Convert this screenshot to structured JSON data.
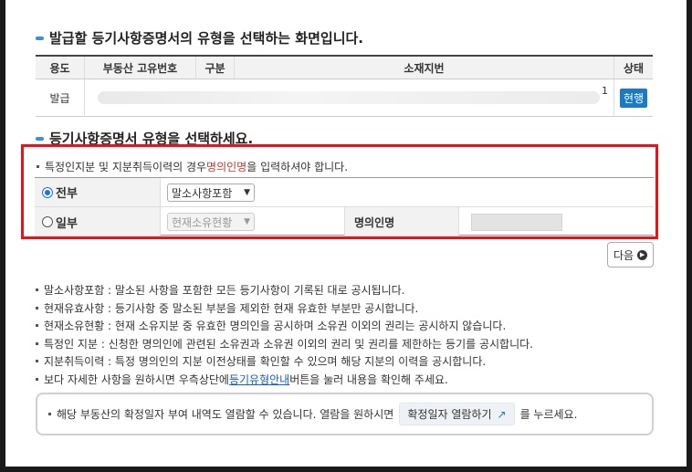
{
  "section1_title": "발급할 등기사항증명서의 유형을 선택하는 화면입니다.",
  "table": {
    "headers": [
      "용도",
      "부동산 고유번호",
      "구분",
      "소재지번",
      "상태"
    ],
    "row": {
      "usage": "발급",
      "address_suffix": "1",
      "status": "현행"
    }
  },
  "section2_title": "등기사항증명서 유형을 선택하세요.",
  "notice": {
    "pre": "특정인지분 및 지분취득이력의 경우 ",
    "highlight": "명의인명",
    "post": "을 입력하셔야 합니다."
  },
  "options": {
    "full": {
      "label": "전부",
      "select_value": "말소사항포함",
      "checked": true
    },
    "partial": {
      "label": "일부",
      "select_value": "현재소유현황",
      "checked": false
    },
    "owner_label": "명의인명"
  },
  "next_button": "다음",
  "info": [
    "말소사항포함 : 말소된 사항을 포함한 모든 등기사항이 기록된 대로 공시됩니다.",
    "현재유효사항 : 등기사항 중 말소된 부분을 제외한 현재 유효한 부분만 공시합니다.",
    "현재소유현황 : 현재 소유지분 중 유효한 명의인을 공시하며 소유권 이외의 권리는 공시하지 않습니다.",
    "특정인 지분 : 신청한 명의인에 관련된 소유권과 소유권 이외의 권리 및 권리를 제한하는 등기를 공시합니다.",
    "지분취득이력 : 특정 명의인의 지분 이전상태를 확인할 수 있으며 해당 지분의 이력을 공시합니다."
  ],
  "info_last": {
    "pre": "보다 자세한 사항을 원하시면 우측상단에 ",
    "link": "등기유형안내",
    "post": "버튼을 눌러 내용을 확인해 주세요."
  },
  "note": {
    "pre": "해당 부동산의 확정일자 부여 내역도 열람할 수 있습니다. 열람을 원하시면 ",
    "button": "확정일자 열람하기",
    "post": "를 누르세요."
  }
}
